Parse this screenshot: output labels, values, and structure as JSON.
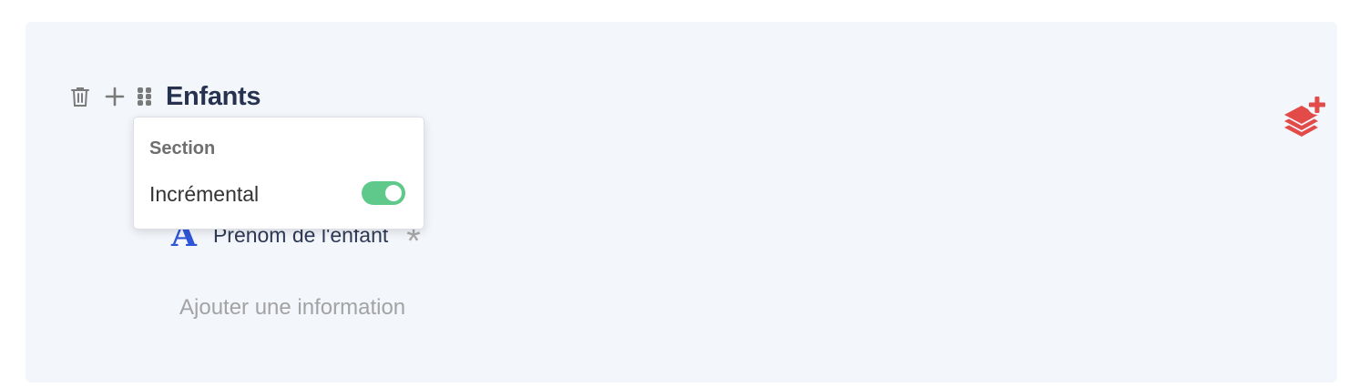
{
  "section": {
    "title": "Enfants"
  },
  "icons": {
    "delete": "trash-icon",
    "add": "plus-icon",
    "drag": "drag-handle-icon",
    "add_section": "layers-plus-icon"
  },
  "field": {
    "type_glyph": "A",
    "label": "Prénom de l'enfant",
    "required_mark": "*"
  },
  "add_info_label": "Ajouter une information",
  "popover": {
    "title": "Section",
    "option_label": "Incrémental",
    "option_enabled": true
  },
  "colors": {
    "title": "#263250",
    "accent_blue": "#2f56d8",
    "toggle_on": "#5fc88b",
    "add_section_red": "#e24b48",
    "card_bg": "#f3f6fb"
  }
}
